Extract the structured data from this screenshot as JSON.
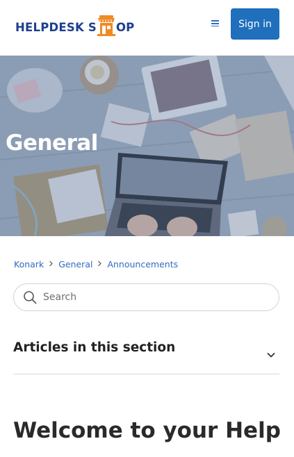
{
  "header": {
    "logo_text_left": "HELPDESK S",
    "logo_text_right": "OP",
    "signin_label": "Sign in"
  },
  "hero": {
    "title": "General"
  },
  "breadcrumb": {
    "items": [
      "Konark",
      "General",
      "Announcements"
    ]
  },
  "search": {
    "placeholder": "Search"
  },
  "articles": {
    "title": "Articles in this section"
  },
  "main": {
    "heading": "Welcome to your Help"
  },
  "colors": {
    "brand_blue": "#1d3f8f",
    "accent_orange": "#f08a24",
    "link_blue": "#2f6bbf",
    "button_blue": "#1f6fbd"
  },
  "icons": [
    "store-icon",
    "menu-icon",
    "search-icon",
    "chevron-right-icon",
    "chevron-down-icon"
  ]
}
